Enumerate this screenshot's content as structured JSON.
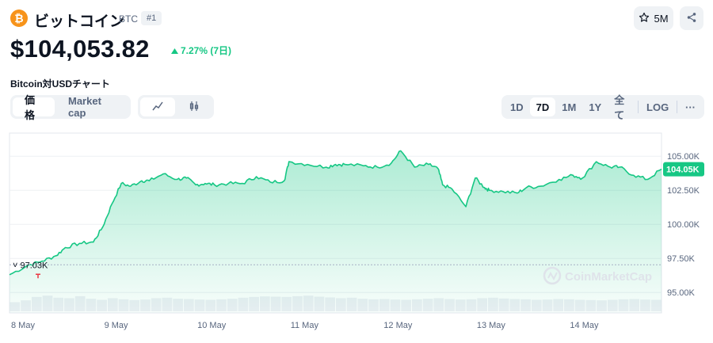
{
  "header": {
    "coin_icon": "bitcoin-icon",
    "coin_icon_glyph": "₿",
    "coin_name": "ビットコイン",
    "symbol": "BTC",
    "rank": "#1",
    "watchlist_count": "5M",
    "star_icon": "star-icon",
    "share_icon": "share-icon"
  },
  "price": {
    "value": "$104,053.82",
    "change": "7.27% (7日)",
    "change_color": "#16c784"
  },
  "chart_title": "Bitcoin対USDチャート",
  "controls": {
    "metric_tabs": [
      "価格",
      "Market cap"
    ],
    "metric_active": 0,
    "chart_type_icons": [
      "line-chart-icon",
      "candlestick-icon"
    ],
    "ranges": [
      "1D",
      "7D",
      "1M",
      "1Y",
      "全て"
    ],
    "range_active": 1,
    "log_label": "LOG",
    "more_label": "···"
  },
  "chart_data": {
    "type": "area",
    "title": "",
    "xlabel": "",
    "ylabel": "",
    "currency": "USD",
    "x_tick_labels": [
      "8 May",
      "9 May",
      "10 May",
      "11 May",
      "12 May",
      "13 May",
      "14 May"
    ],
    "y_tick_labels": [
      "105.00K",
      "102.50K",
      "100.00K",
      "97.50K",
      "95.00K"
    ],
    "y_ticks": [
      105000,
      102500,
      100000,
      97500,
      95000
    ],
    "ylim": [
      93500,
      106700
    ],
    "xlim": [
      0,
      7.0
    ],
    "series": [
      {
        "x": [
          0.0,
          0.2,
          0.35,
          0.5,
          0.6,
          0.75,
          0.9,
          1.0,
          1.1,
          1.2,
          1.3,
          1.42,
          1.5,
          1.65,
          1.8,
          1.9,
          2.0,
          2.1,
          2.2,
          2.35,
          2.5,
          2.65,
          2.8,
          2.95,
          3.0,
          3.2,
          3.4,
          3.5,
          3.6,
          3.8,
          3.95,
          4.1,
          4.2,
          4.35,
          4.5,
          4.6,
          4.65,
          4.75,
          4.9,
          5.0,
          5.1,
          5.15,
          5.3,
          5.45,
          5.55,
          5.7,
          5.9,
          6.05,
          6.15,
          6.3,
          6.45,
          6.55,
          6.7,
          6.85,
          7.0
        ],
        "y": [
          96300,
          97000,
          97300,
          97700,
          98300,
          98600,
          98700,
          99800,
          101500,
          103000,
          102800,
          103200,
          103200,
          103700,
          103300,
          103400,
          102900,
          103000,
          102900,
          103000,
          103000,
          103500,
          103100,
          103200,
          104600,
          104400,
          104200,
          104400,
          104400,
          104300,
          104200,
          104500,
          105400,
          104200,
          104400,
          104100,
          102900,
          102600,
          101300,
          103400,
          102700,
          102500,
          102400,
          102300,
          102700,
          102800,
          103300,
          103600,
          103400,
          104600,
          104200,
          104200,
          103600,
          103300,
          104050
        ]
      }
    ],
    "line_color": "#16c784",
    "last_value_label": "104.05K",
    "last_value": 104050,
    "start_value_label": "97.03K",
    "start_value": 97030,
    "grid": true,
    "volume": [
      0.35,
      0.42,
      0.55,
      0.6,
      0.52,
      0.5,
      0.58,
      0.48,
      0.44,
      0.5,
      0.46,
      0.43,
      0.45,
      0.5,
      0.52,
      0.48,
      0.47,
      0.45,
      0.44,
      0.46,
      0.48,
      0.52,
      0.55,
      0.57,
      0.56,
      0.55,
      0.58,
      0.6,
      0.56,
      0.53,
      0.5,
      0.52,
      0.48,
      0.46,
      0.47,
      0.45,
      0.44,
      0.46,
      0.48,
      0.5,
      0.47,
      0.45,
      0.46,
      0.5,
      0.52,
      0.49,
      0.47,
      0.46,
      0.44,
      0.45,
      0.47,
      0.46,
      0.44,
      0.43,
      0.42,
      0.44,
      0.46,
      0.47,
      0.45,
      0.44
    ],
    "watermark": "CoinMarketCap"
  }
}
